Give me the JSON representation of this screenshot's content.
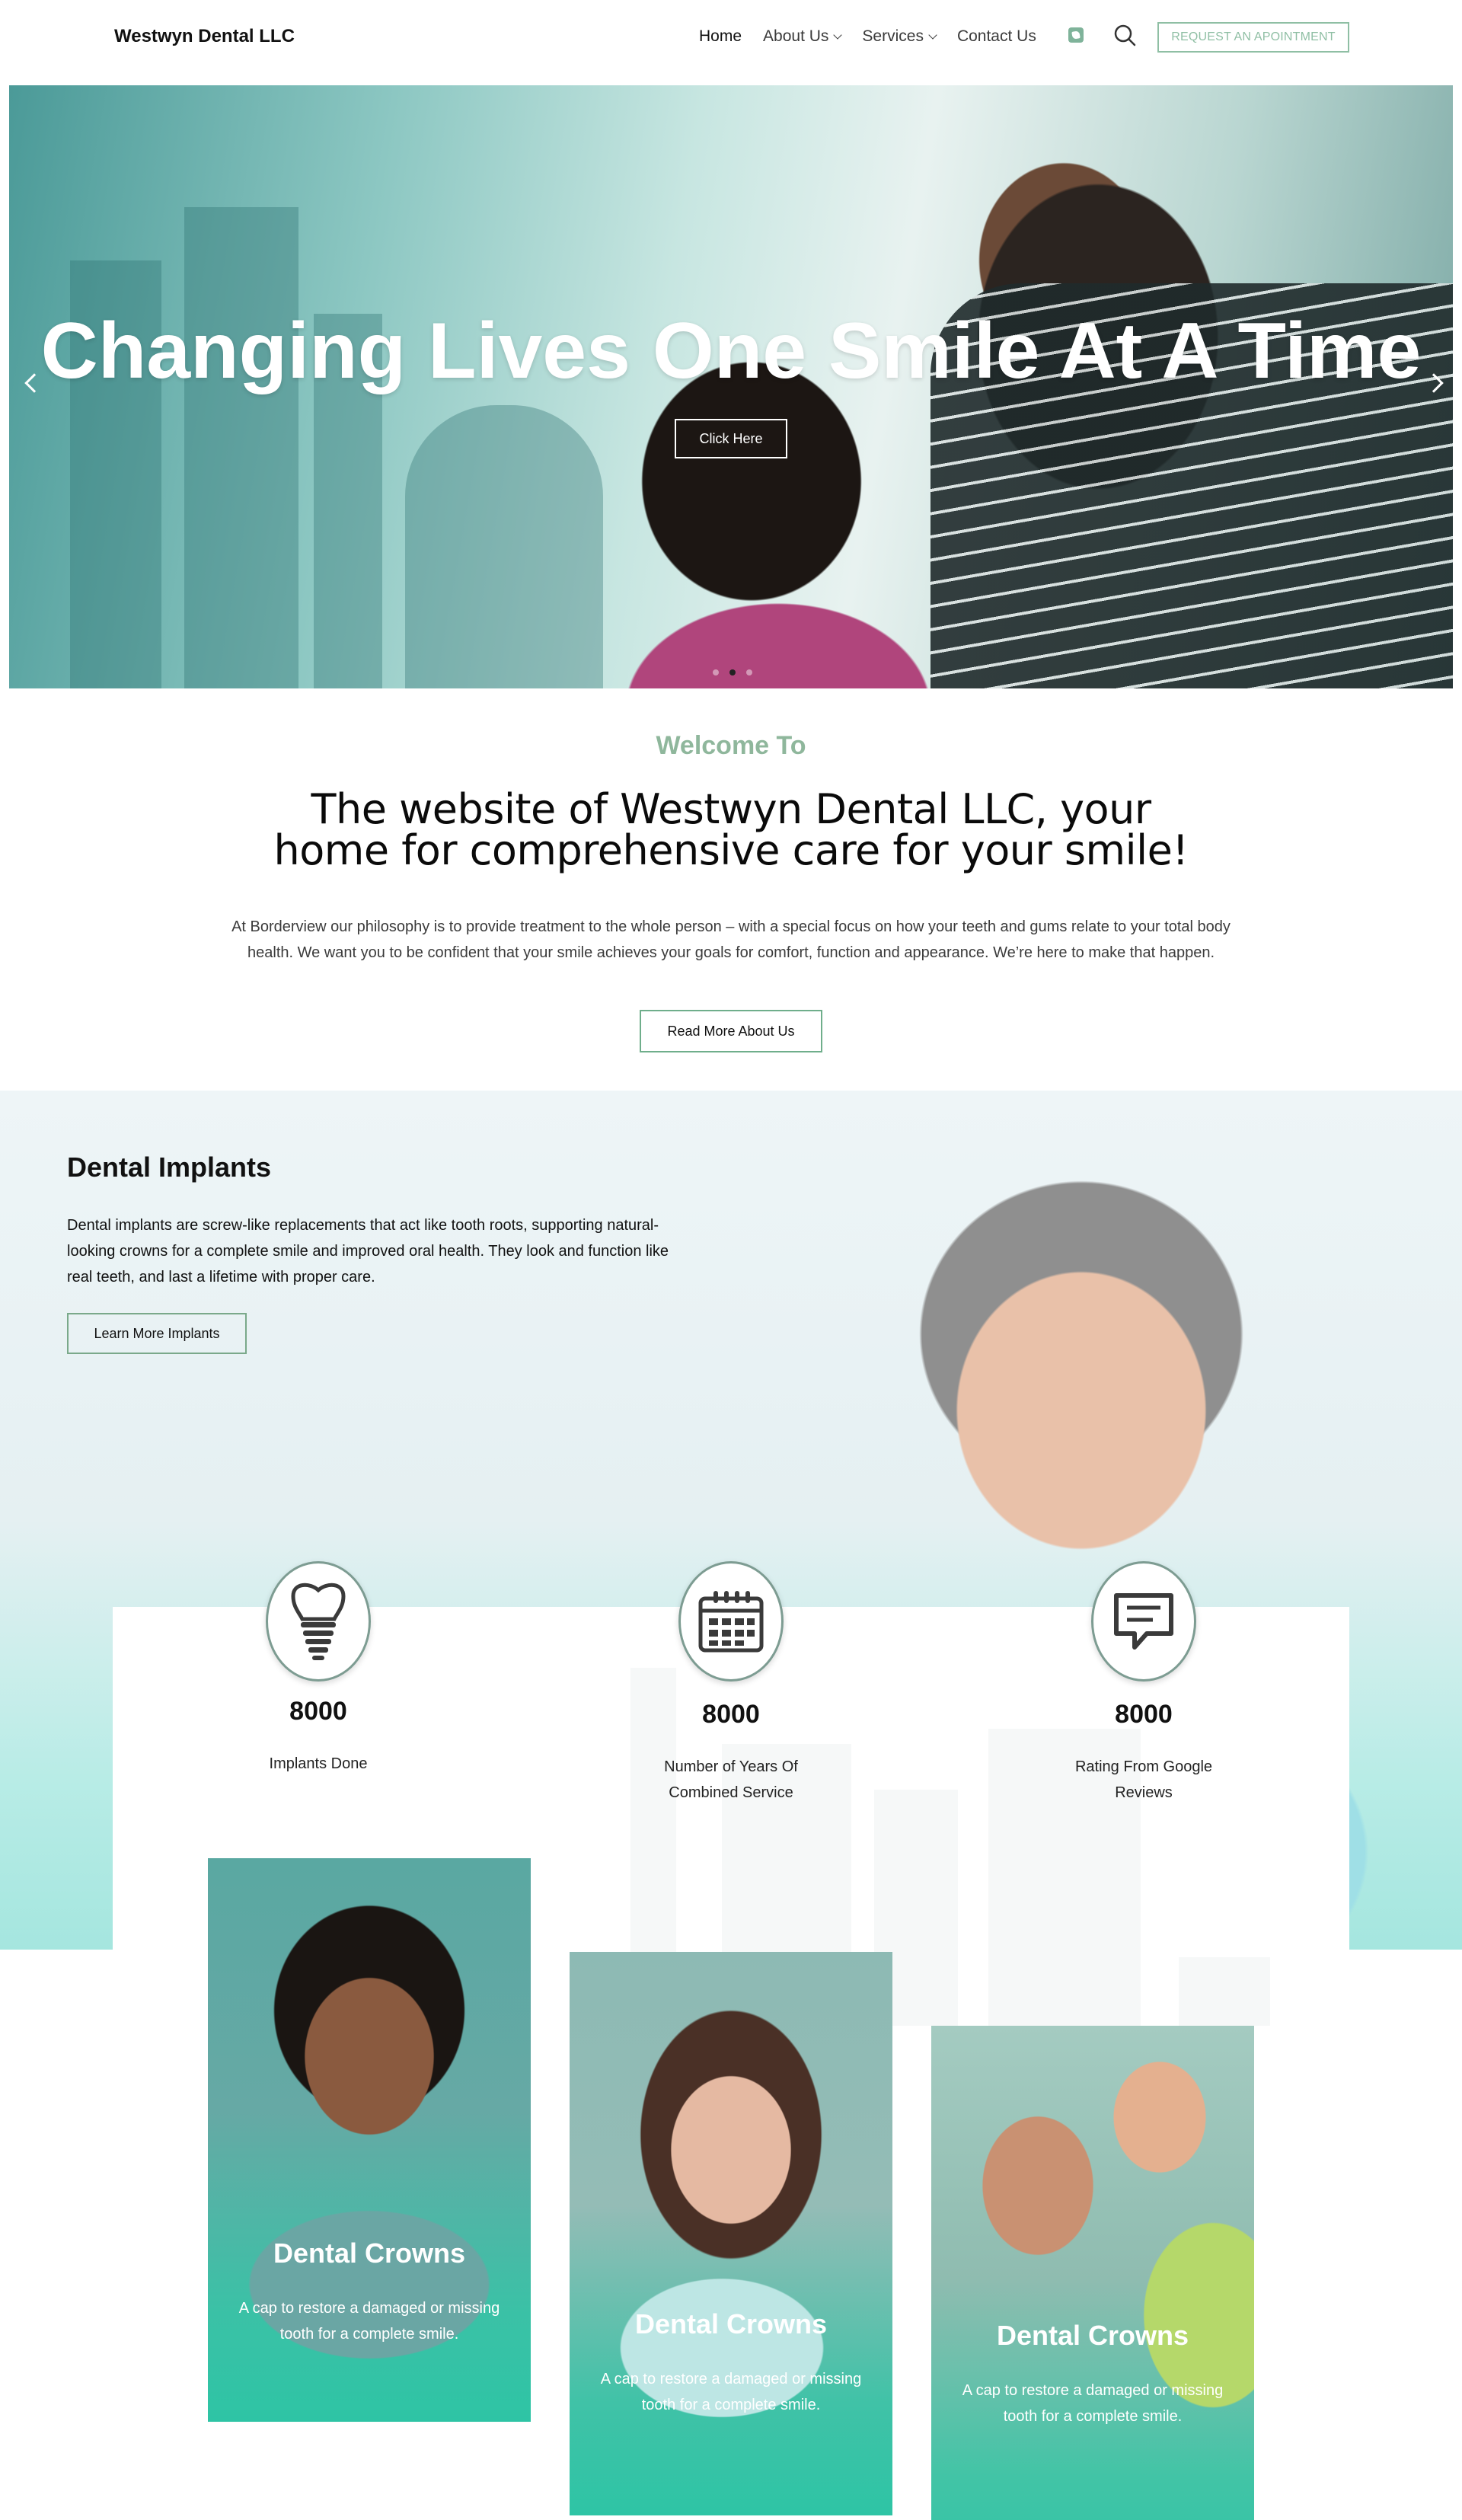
{
  "header": {
    "logo": "Westwyn Dental LLC",
    "nav": [
      {
        "label": "Home",
        "dropdown": false
      },
      {
        "label": "About Us",
        "dropdown": true
      },
      {
        "label": "Services",
        "dropdown": true
      },
      {
        "label": "Contact Us",
        "dropdown": false
      }
    ],
    "icons": [
      "phone-icon",
      "search-icon"
    ],
    "cta_label": "REQUEST AN APOINTMENT"
  },
  "hero": {
    "title": "Changing Lives One Smile At A Time",
    "button_label": "Click Here",
    "slides": 3,
    "active_slide": 2
  },
  "welcome": {
    "label": "Welcome To",
    "title": "The website of Westwyn Dental LLC, your home for comprehensive care for your smile!",
    "text": "At Borderview our philosophy is to provide treatment to the whole person – with a special focus on how your teeth and gums relate to your total body health. We want you to be confident that your smile achieves your goals for comfort, function and appearance. We’re here to make that happen.",
    "button_label": "Read More About Us"
  },
  "implants": {
    "title": "Dental Implants",
    "text": "Dental implants are screw-like replacements that act like tooth roots, supporting natural-looking crowns for a complete smile and improved oral health. They look and function like real teeth, and last a lifetime with proper care.",
    "button_label": "Learn More Implants"
  },
  "stats": [
    {
      "icon": "tooth-implant-icon",
      "number": "8000",
      "label": "Implants Done"
    },
    {
      "icon": "calendar-icon",
      "number": "8000",
      "label": "Number of Years Of Combined Service"
    },
    {
      "icon": "review-chat-icon",
      "number": "8000",
      "label": "Rating From Google Reviews"
    }
  ],
  "cards": [
    {
      "title": "Dental Crowns",
      "text": "A cap to restore a damaged or missing tooth for a complete smile."
    },
    {
      "title": "Dental Crowns",
      "text": "A cap to restore a damaged or missing tooth for a complete smile."
    },
    {
      "title": "Dental Crowns",
      "text": "A cap to restore a damaged or missing tooth for a complete smile."
    }
  ],
  "colors": {
    "accent_green": "#8fb79c",
    "button_border": "#6fae8b",
    "teal": "#2ec4a5"
  }
}
